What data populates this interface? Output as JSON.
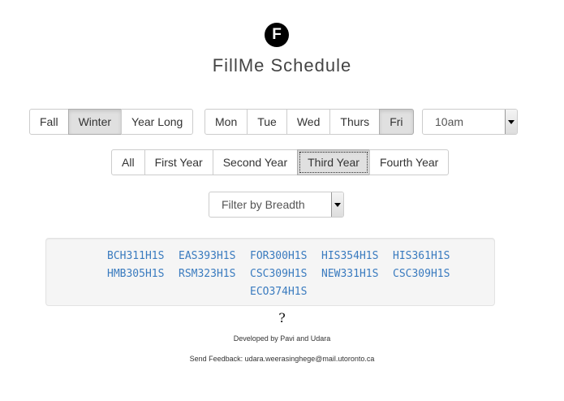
{
  "app": {
    "logo_letter": "F",
    "title": "FillMe Schedule"
  },
  "term_filter": {
    "options": [
      "Fall",
      "Winter",
      "Year Long"
    ],
    "selected": "Winter"
  },
  "day_filter": {
    "options": [
      "Mon",
      "Tue",
      "Wed",
      "Thurs",
      "Fri"
    ],
    "selected": "Fri"
  },
  "time_select": {
    "value": "10am"
  },
  "year_filter": {
    "options": [
      "All",
      "First Year",
      "Second Year",
      "Third Year",
      "Fourth Year"
    ],
    "selected": "Third Year"
  },
  "breadth_select": {
    "value": "Filter by Breadth"
  },
  "courses": [
    "BCH311H1S",
    "EAS393H1S",
    "FOR300H1S",
    "HIS354H1S",
    "HIS361H1S",
    "HMB305H1S",
    "RSM323H1S",
    "CSC309H1S",
    "NEW331H1S",
    "CSC309H1S",
    "ECO374H1S"
  ],
  "help": {
    "symbol": "?"
  },
  "footer": {
    "credits": "Developed by Pavi and Udara",
    "feedback_label": "Send Feedback: ",
    "feedback_email": "udara.weerasinghege@mail.utoronto.ca"
  },
  "colors": {
    "link": "#3a7bbf",
    "active_button": "#e0e0e0",
    "well_background": "#f5f5f5"
  },
  "icons": {
    "logo": "f-logo-icon",
    "dropdown": "chevron-down-icon"
  }
}
